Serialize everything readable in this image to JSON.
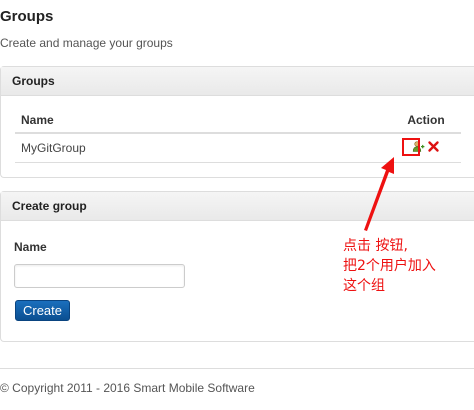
{
  "page": {
    "title": "Groups",
    "subtitle": "Create and manage your groups"
  },
  "groups_panel": {
    "heading": "Groups",
    "columns": {
      "name": "Name",
      "action": "Action"
    },
    "rows": [
      {
        "name": "MyGitGroup",
        "actions": [
          "add-user-icon",
          "delete-icon"
        ]
      }
    ]
  },
  "create_panel": {
    "heading": "Create group",
    "name_label": "Name",
    "name_value": "",
    "create_button": "Create"
  },
  "annotation": {
    "lines": [
      "点击 按钮,",
      "把2个用户加入",
      "这个组"
    ],
    "color": "#ee1111"
  },
  "footer": {
    "copyright": "© Copyright 2011 - 2016 Smart Mobile Software"
  },
  "colors": {
    "primary_button": "#0b5aa5",
    "panel_heading_bg": "#efefef",
    "border": "#dddddd",
    "delete_icon": "#dd1111",
    "add_user_icon": "#6a9a2a"
  }
}
